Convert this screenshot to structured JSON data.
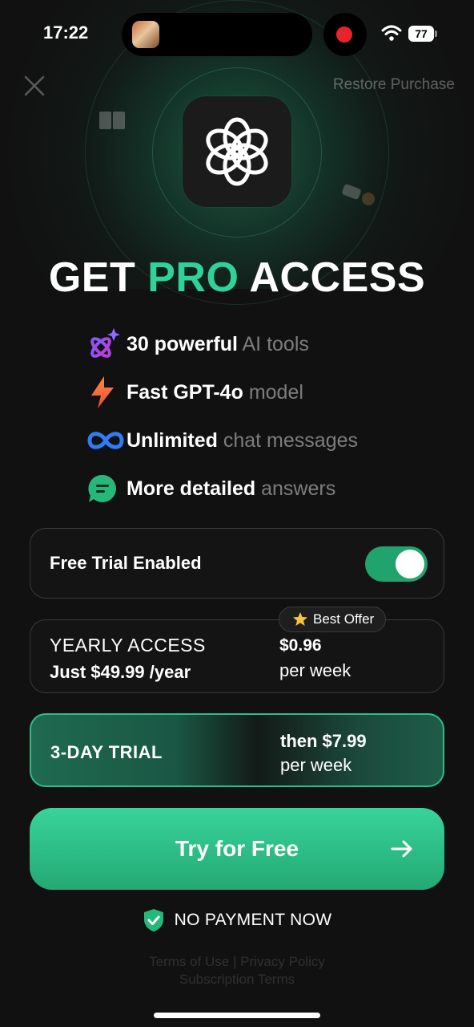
{
  "status_bar": {
    "time": "17:22",
    "battery": "77"
  },
  "header": {
    "restore_label": "Restore Purchase"
  },
  "hero": {
    "title_part1": "GET",
    "title_part2": "PRO",
    "title_part3": "ACCESS",
    "accent_color": "#2fd39a"
  },
  "features": [
    {
      "bold": "30 powerful",
      "rest": "AI tools",
      "icon": "sparkle-atom-icon"
    },
    {
      "bold": "Fast GPT-4o",
      "rest": "model",
      "icon": "lightning-icon"
    },
    {
      "bold": "Unlimited",
      "rest": "chat messages",
      "icon": "infinity-icon"
    },
    {
      "bold": "More detailed",
      "rest": "answers",
      "icon": "chat-bubble-icon"
    }
  ],
  "free_trial": {
    "label": "Free Trial Enabled",
    "enabled": true
  },
  "yearly": {
    "title": "YEARLY ACCESS",
    "subtitle": "Just $49.99 /year",
    "price": "$0.96",
    "period": "per week",
    "badge": "Best Offer"
  },
  "trial_plan": {
    "title": "3-DAY TRIAL",
    "price": "then $7.99",
    "period": "per week"
  },
  "cta": {
    "label": "Try for Free"
  },
  "assurance": {
    "label": "NO PAYMENT NOW"
  },
  "legal": {
    "terms": "Terms of Use",
    "separator": "|",
    "privacy": "Privacy Policy",
    "subscription": "Subscription Terms"
  }
}
